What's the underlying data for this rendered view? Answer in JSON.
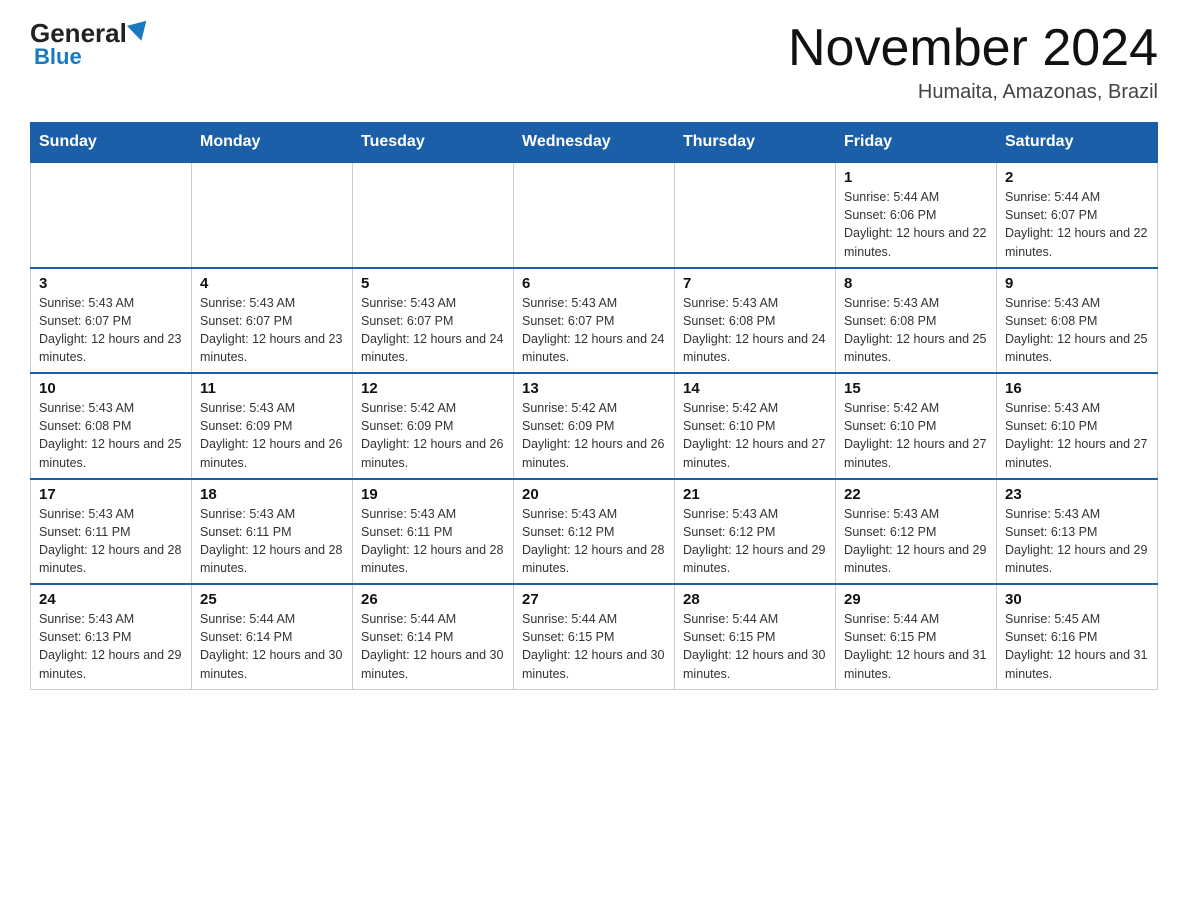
{
  "logo": {
    "general": "General",
    "blue": "Blue"
  },
  "title": "November 2024",
  "subtitle": "Humaita, Amazonas, Brazil",
  "days_of_week": [
    "Sunday",
    "Monday",
    "Tuesday",
    "Wednesday",
    "Thursday",
    "Friday",
    "Saturday"
  ],
  "weeks": [
    [
      {
        "day": "",
        "info": ""
      },
      {
        "day": "",
        "info": ""
      },
      {
        "day": "",
        "info": ""
      },
      {
        "day": "",
        "info": ""
      },
      {
        "day": "",
        "info": ""
      },
      {
        "day": "1",
        "info": "Sunrise: 5:44 AM\nSunset: 6:06 PM\nDaylight: 12 hours and 22 minutes."
      },
      {
        "day": "2",
        "info": "Sunrise: 5:44 AM\nSunset: 6:07 PM\nDaylight: 12 hours and 22 minutes."
      }
    ],
    [
      {
        "day": "3",
        "info": "Sunrise: 5:43 AM\nSunset: 6:07 PM\nDaylight: 12 hours and 23 minutes."
      },
      {
        "day": "4",
        "info": "Sunrise: 5:43 AM\nSunset: 6:07 PM\nDaylight: 12 hours and 23 minutes."
      },
      {
        "day": "5",
        "info": "Sunrise: 5:43 AM\nSunset: 6:07 PM\nDaylight: 12 hours and 24 minutes."
      },
      {
        "day": "6",
        "info": "Sunrise: 5:43 AM\nSunset: 6:07 PM\nDaylight: 12 hours and 24 minutes."
      },
      {
        "day": "7",
        "info": "Sunrise: 5:43 AM\nSunset: 6:08 PM\nDaylight: 12 hours and 24 minutes."
      },
      {
        "day": "8",
        "info": "Sunrise: 5:43 AM\nSunset: 6:08 PM\nDaylight: 12 hours and 25 minutes."
      },
      {
        "day": "9",
        "info": "Sunrise: 5:43 AM\nSunset: 6:08 PM\nDaylight: 12 hours and 25 minutes."
      }
    ],
    [
      {
        "day": "10",
        "info": "Sunrise: 5:43 AM\nSunset: 6:08 PM\nDaylight: 12 hours and 25 minutes."
      },
      {
        "day": "11",
        "info": "Sunrise: 5:43 AM\nSunset: 6:09 PM\nDaylight: 12 hours and 26 minutes."
      },
      {
        "day": "12",
        "info": "Sunrise: 5:42 AM\nSunset: 6:09 PM\nDaylight: 12 hours and 26 minutes."
      },
      {
        "day": "13",
        "info": "Sunrise: 5:42 AM\nSunset: 6:09 PM\nDaylight: 12 hours and 26 minutes."
      },
      {
        "day": "14",
        "info": "Sunrise: 5:42 AM\nSunset: 6:10 PM\nDaylight: 12 hours and 27 minutes."
      },
      {
        "day": "15",
        "info": "Sunrise: 5:42 AM\nSunset: 6:10 PM\nDaylight: 12 hours and 27 minutes."
      },
      {
        "day": "16",
        "info": "Sunrise: 5:43 AM\nSunset: 6:10 PM\nDaylight: 12 hours and 27 minutes."
      }
    ],
    [
      {
        "day": "17",
        "info": "Sunrise: 5:43 AM\nSunset: 6:11 PM\nDaylight: 12 hours and 28 minutes."
      },
      {
        "day": "18",
        "info": "Sunrise: 5:43 AM\nSunset: 6:11 PM\nDaylight: 12 hours and 28 minutes."
      },
      {
        "day": "19",
        "info": "Sunrise: 5:43 AM\nSunset: 6:11 PM\nDaylight: 12 hours and 28 minutes."
      },
      {
        "day": "20",
        "info": "Sunrise: 5:43 AM\nSunset: 6:12 PM\nDaylight: 12 hours and 28 minutes."
      },
      {
        "day": "21",
        "info": "Sunrise: 5:43 AM\nSunset: 6:12 PM\nDaylight: 12 hours and 29 minutes."
      },
      {
        "day": "22",
        "info": "Sunrise: 5:43 AM\nSunset: 6:12 PM\nDaylight: 12 hours and 29 minutes."
      },
      {
        "day": "23",
        "info": "Sunrise: 5:43 AM\nSunset: 6:13 PM\nDaylight: 12 hours and 29 minutes."
      }
    ],
    [
      {
        "day": "24",
        "info": "Sunrise: 5:43 AM\nSunset: 6:13 PM\nDaylight: 12 hours and 29 minutes."
      },
      {
        "day": "25",
        "info": "Sunrise: 5:44 AM\nSunset: 6:14 PM\nDaylight: 12 hours and 30 minutes."
      },
      {
        "day": "26",
        "info": "Sunrise: 5:44 AM\nSunset: 6:14 PM\nDaylight: 12 hours and 30 minutes."
      },
      {
        "day": "27",
        "info": "Sunrise: 5:44 AM\nSunset: 6:15 PM\nDaylight: 12 hours and 30 minutes."
      },
      {
        "day": "28",
        "info": "Sunrise: 5:44 AM\nSunset: 6:15 PM\nDaylight: 12 hours and 30 minutes."
      },
      {
        "day": "29",
        "info": "Sunrise: 5:44 AM\nSunset: 6:15 PM\nDaylight: 12 hours and 31 minutes."
      },
      {
        "day": "30",
        "info": "Sunrise: 5:45 AM\nSunset: 6:16 PM\nDaylight: 12 hours and 31 minutes."
      }
    ]
  ]
}
